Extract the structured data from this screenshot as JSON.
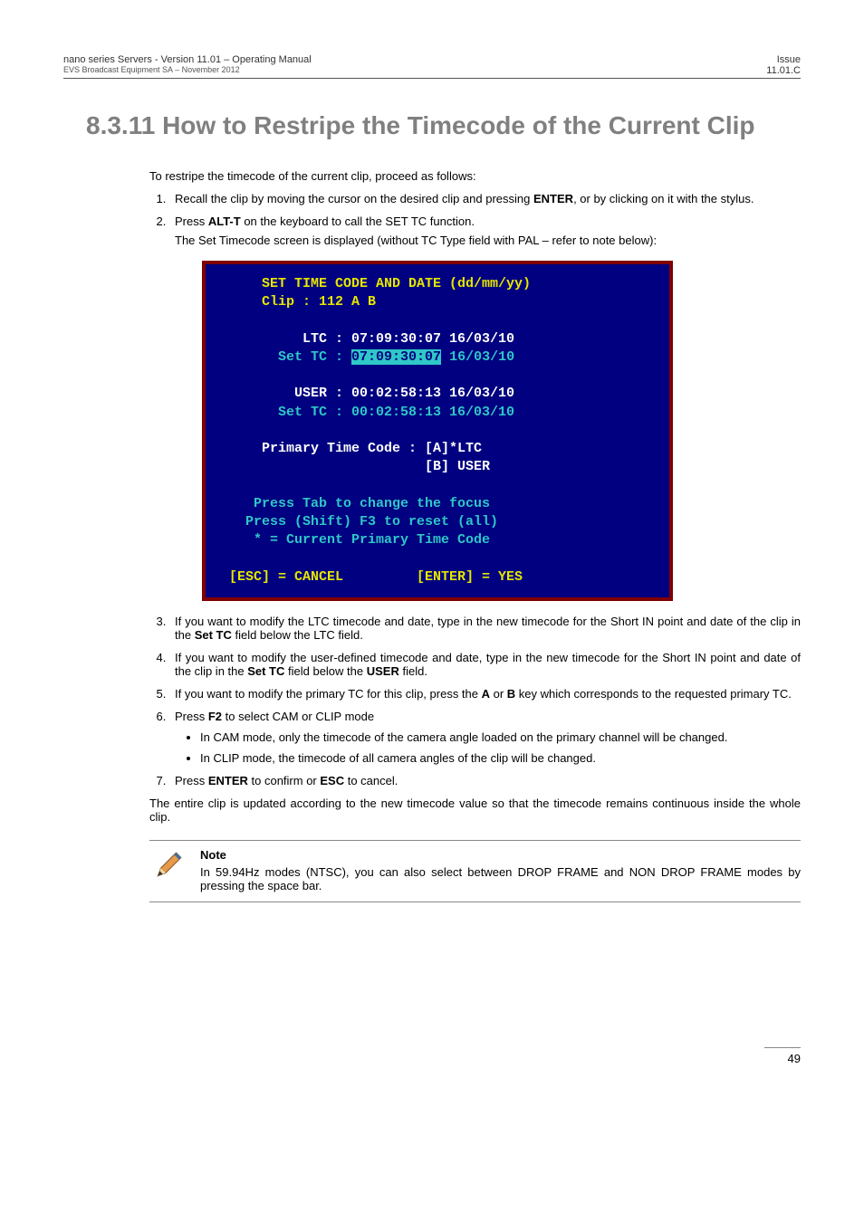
{
  "header": {
    "left_top": "nano series Servers - Version 11.01 – Operating Manual",
    "left_sub": "EVS Broadcast Equipment SA – November 2012",
    "right_top": "Issue",
    "right_sub": "11.01.C"
  },
  "heading": "8.3.11 How to Restripe the Timecode of the Current Clip",
  "intro": "To restripe the timecode of the current clip, proceed as follows:",
  "steps": {
    "s1_a": "Recall the clip by moving the cursor on the desired clip and pressing ",
    "s1_enter": "ENTER",
    "s1_b": ", or by clicking on it with the stylus.",
    "s2_a": "Press ",
    "s2_alt": "ALT-T",
    "s2_b": " on the keyboard to call the SET TC function.",
    "s2_sub": "The Set Timecode screen is displayed (without TC Type field with PAL – refer to note below):",
    "s3_a": "If you want to modify the LTC timecode and date, type in the new timecode for the Short IN point and date of the clip in the ",
    "s3_set": "Set TC",
    "s3_b": " field below the LTC field.",
    "s4_a": "If you want to modify the user-defined timecode and date, type in the new timecode for the Short IN point and date of the clip in the ",
    "s4_set": "Set TC",
    "s4_b": " field below the ",
    "s4_user": "USER",
    "s4_c": " field.",
    "s5_a": "If you want to modify the primary TC for this clip, press the ",
    "s5_A": "A",
    "s5_b": " or ",
    "s5_B": "B",
    "s5_c": " key which corresponds to the requested primary TC.",
    "s6_a": "Press ",
    "s6_f2": "F2",
    "s6_b": " to select CAM or CLIP mode",
    "s6_bul1": "In CAM mode, only the timecode of the camera angle loaded on the primary channel will be changed.",
    "s6_bul2": "In CLIP mode, the timecode of all camera angles of the clip will be changed.",
    "s7_a": "Press ",
    "s7_enter": "ENTER",
    "s7_b": " to confirm or ",
    "s7_esc": "ESC",
    "s7_c": " to cancel."
  },
  "terminal": {
    "l1": "      SET TIME CODE AND DATE (dd/mm/yy)",
    "l2": "      Clip : 112 A B",
    "l3": "           LTC : 07:09:30:07 16/03/10",
    "l4a": "        Set TC : ",
    "l4b": "07:09:30:07",
    "l4c": " 16/03/10",
    "l5": "          USER : 00:02:58:13 16/03/10",
    "l6": "        Set TC : 00:02:58:13 16/03/10",
    "l7": "      Primary Time Code : [A]*LTC",
    "l8": "                          [B] USER",
    "l9": "     Press Tab to change the focus",
    "l10": "    Press (Shift) F3 to reset (all)",
    "l11": "     * = Current Primary Time Code",
    "l12": "  [ESC] = CANCEL         [ENTER] = YES"
  },
  "closing": "The entire clip is updated according to the new timecode value so that the timecode remains continuous inside the whole clip.",
  "note": {
    "title": "Note",
    "body": "In 59.94Hz modes (NTSC), you can also select between DROP FRAME and NON DROP FRAME modes by pressing the space bar."
  },
  "page_number": "49"
}
